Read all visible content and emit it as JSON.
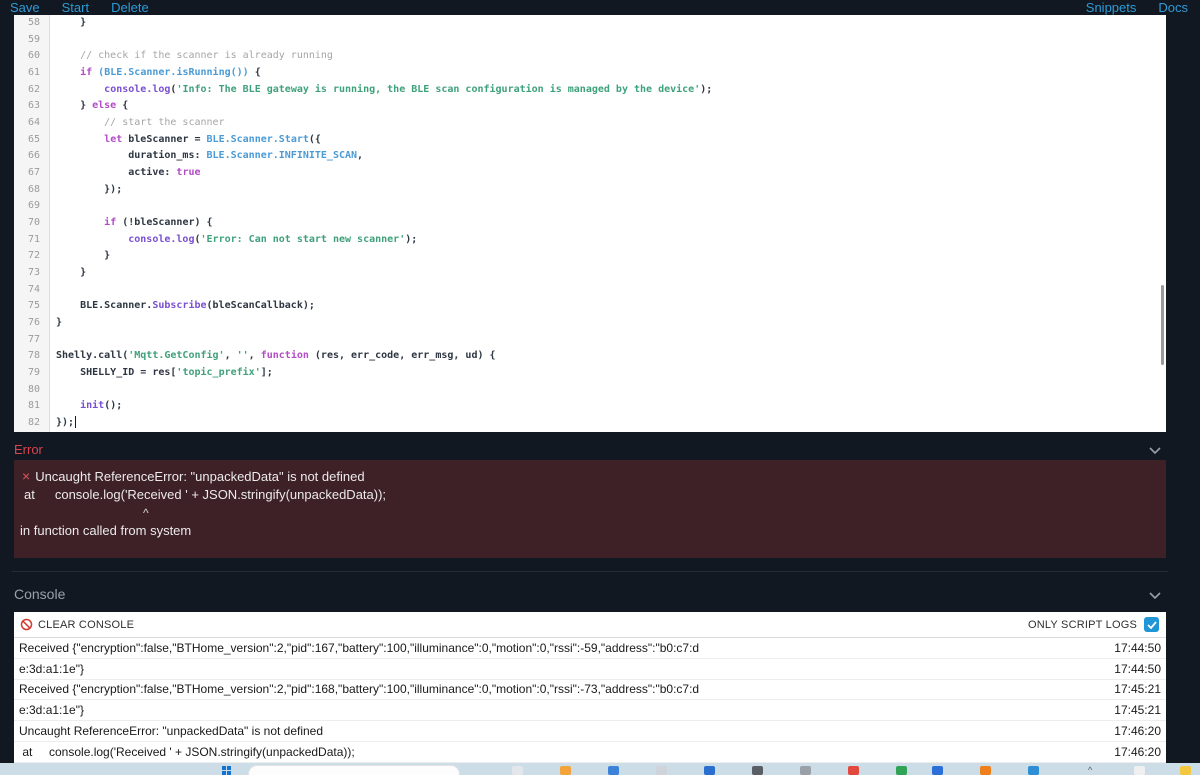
{
  "toolbar": {
    "left": [
      "Save",
      "Start",
      "Delete"
    ],
    "right": [
      "Snippets",
      "Docs"
    ]
  },
  "editor": {
    "lines": [
      {
        "n": 58,
        "tokens": [
          [
            "    }",
            "pl"
          ]
        ]
      },
      {
        "n": 59,
        "tokens": []
      },
      {
        "n": 60,
        "tokens": [
          [
            "    // check if the scanner is already running",
            "cm"
          ]
        ]
      },
      {
        "n": 61,
        "tokens": [
          [
            "    ",
            "pl"
          ],
          [
            "if",
            "kw"
          ],
          [
            " ",
            "pl"
          ],
          [
            "(BLE.Scanner.isRunning())",
            "bi"
          ],
          [
            " {",
            "pl"
          ]
        ]
      },
      {
        "n": 62,
        "tokens": [
          [
            "        ",
            "pl"
          ],
          [
            "console.log",
            "fn"
          ],
          [
            "(",
            "pl"
          ],
          [
            "'Info: The BLE gateway is running, the BLE scan configuration is managed by the device'",
            "st"
          ],
          [
            ");",
            "pl"
          ]
        ]
      },
      {
        "n": 63,
        "tokens": [
          [
            "    } ",
            "pl"
          ],
          [
            "else",
            "kw"
          ],
          [
            " {",
            "pl"
          ]
        ]
      },
      {
        "n": 64,
        "tokens": [
          [
            "        // start the scanner",
            "cm"
          ]
        ]
      },
      {
        "n": 65,
        "tokens": [
          [
            "        ",
            "pl"
          ],
          [
            "let",
            "kw"
          ],
          [
            " bleScanner = ",
            "pl"
          ],
          [
            "BLE.Scanner.Start",
            "bi"
          ],
          [
            "({",
            "pl"
          ]
        ]
      },
      {
        "n": 66,
        "tokens": [
          [
            "            duration_ms: ",
            "pl"
          ],
          [
            "BLE.Scanner.INFINITE_SCAN",
            "bi"
          ],
          [
            ",",
            "pl"
          ]
        ]
      },
      {
        "n": 67,
        "tokens": [
          [
            "            active: ",
            "pl"
          ],
          [
            "true",
            "kw"
          ]
        ]
      },
      {
        "n": 68,
        "tokens": [
          [
            "        });",
            "pl"
          ]
        ]
      },
      {
        "n": 69,
        "tokens": []
      },
      {
        "n": 70,
        "tokens": [
          [
            "        ",
            "pl"
          ],
          [
            "if",
            "kw"
          ],
          [
            " (!bleScanner) {",
            "pl"
          ]
        ]
      },
      {
        "n": 71,
        "tokens": [
          [
            "            ",
            "pl"
          ],
          [
            "console.log",
            "fn"
          ],
          [
            "(",
            "pl"
          ],
          [
            "'Error: Can not start new scanner'",
            "st"
          ],
          [
            ");",
            "pl"
          ]
        ]
      },
      {
        "n": 72,
        "tokens": [
          [
            "        }",
            "pl"
          ]
        ]
      },
      {
        "n": 73,
        "tokens": [
          [
            "    }",
            "pl"
          ]
        ]
      },
      {
        "n": 74,
        "tokens": []
      },
      {
        "n": 75,
        "tokens": [
          [
            "    BLE.Scanner.",
            "pl"
          ],
          [
            "Subscribe",
            "fn"
          ],
          [
            "(bleScanCallback);",
            "pl"
          ]
        ]
      },
      {
        "n": 76,
        "tokens": [
          [
            "}",
            "pl"
          ]
        ]
      },
      {
        "n": 77,
        "tokens": []
      },
      {
        "n": 78,
        "tokens": [
          [
            "Shelly.call(",
            "pl"
          ],
          [
            "'Mqtt.GetConfig'",
            "st"
          ],
          [
            ", ",
            "pl"
          ],
          [
            "''",
            "st"
          ],
          [
            ", ",
            "pl"
          ],
          [
            "function",
            "kw"
          ],
          [
            " (res, err_code, err_msg, ud) {",
            "pl"
          ]
        ]
      },
      {
        "n": 79,
        "tokens": [
          [
            "    SHELLY_ID = res[",
            "pl"
          ],
          [
            "'topic_prefix'",
            "st"
          ],
          [
            "];",
            "pl"
          ]
        ]
      },
      {
        "n": 80,
        "tokens": []
      },
      {
        "n": 81,
        "tokens": [
          [
            "    ",
            "pl"
          ],
          [
            "init",
            "fn"
          ],
          [
            "();",
            "pl"
          ]
        ]
      },
      {
        "n": 82,
        "tokens": [
          [
            "});",
            "pl"
          ]
        ],
        "cursor": true
      }
    ]
  },
  "error_panel": {
    "title": "Error",
    "close_glyph": "×",
    "message": "Uncaught ReferenceError: \"unpackedData\" is not defined",
    "at_label": "at",
    "at_code": "console.log('Received ' + JSON.stringify(unpackedData));",
    "caret": "^",
    "context": "in function called from system"
  },
  "console_panel": {
    "title": "Console",
    "clear_button": "CLEAR CONSOLE",
    "filter_label": "ONLY SCRIPT LOGS",
    "filter_checked": true,
    "rows": [
      {
        "text": "Received {\"encryption\":false,\"BTHome_version\":2,\"pid\":167,\"battery\":100,\"illuminance\":0,\"motion\":0,\"rssi\":-59,\"address\":\"b0:c7:d",
        "time": "17:44:50"
      },
      {
        "text": "e:3d:a1:1e\"}",
        "time": "17:44:50"
      },
      {
        "text": "Received {\"encryption\":false,\"BTHome_version\":2,\"pid\":168,\"battery\":100,\"illuminance\":0,\"motion\":0,\"rssi\":-73,\"address\":\"b0:c7:d",
        "time": "17:45:21"
      },
      {
        "text": "e:3d:a1:1e\"}",
        "time": "17:45:21"
      },
      {
        "text": "Uncaught ReferenceError: \"unpackedData\" is not defined",
        "time": "17:46:20"
      },
      {
        "text": " at     console.log('Received ' + JSON.stringify(unpackedData));",
        "time": "17:46:20"
      }
    ]
  },
  "taskbar": {
    "tray_expand_glyph": "^",
    "app_icon_colors": [
      "#e3e6ea",
      "#f2a33c",
      "#3b82d8",
      "#cfd4da",
      "#2a6fd0",
      "#5a5f66",
      "#9aa0a8",
      "#e2483d",
      "#31a357",
      "#2b70d9",
      "#ef7f1a",
      "#2e8fd4",
      "#f0f0f0",
      "#f3c83f"
    ]
  },
  "colors": {
    "accent_blue": "#2e9bd6",
    "error_red": "#d9444f",
    "error_bg": "#3d2127",
    "page_bg": "#111822",
    "checkbox_blue": "#2196d6"
  }
}
